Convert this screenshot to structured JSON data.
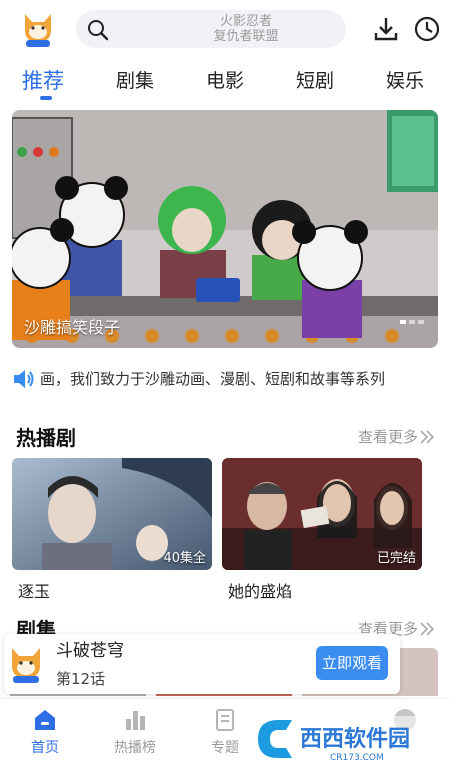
{
  "search": {
    "placeholder_line1": "火影忍者",
    "placeholder_line2": "复仇者联盟"
  },
  "tabs": [
    "推荐",
    "剧集",
    "电影",
    "短剧",
    "娱乐"
  ],
  "banner": {
    "title": "沙雕搞笑段子"
  },
  "notice": {
    "text": "画，我们致力于沙雕动画、漫剧、短剧和故事等系列"
  },
  "hot": {
    "title": "热播剧",
    "more": "查看更多",
    "cards": [
      {
        "name": "逐玉",
        "badge": "40集全"
      },
      {
        "name": "她的盛焰",
        "badge": "已完结"
      }
    ]
  },
  "series": {
    "title": "剧集",
    "more": "查看更多"
  },
  "mini_player": {
    "title": "斗破苍穹",
    "episode": "第12话",
    "button": "立即观看"
  },
  "nav": [
    "首页",
    "热播榜",
    "专题",
    "我的"
  ],
  "watermark": {
    "brand": "西西软件园",
    "domain": "CR173.COM"
  },
  "colors": {
    "accent": "#2f6fe6",
    "button": "#3b8cf0"
  }
}
